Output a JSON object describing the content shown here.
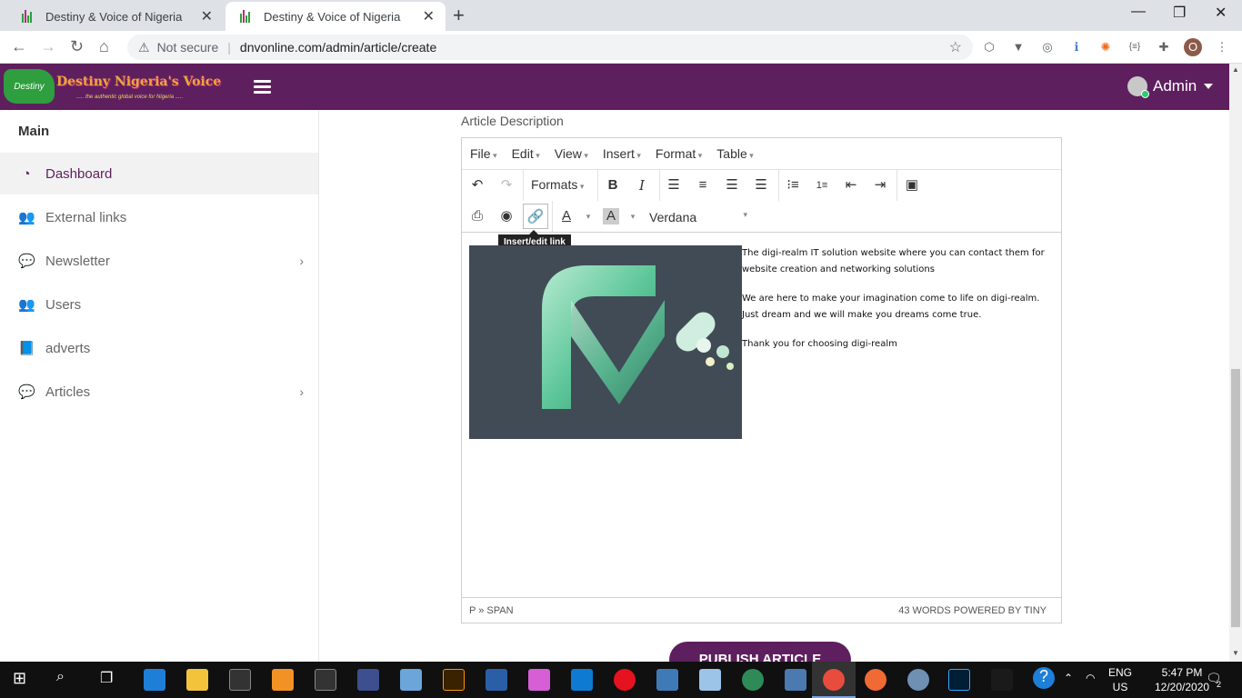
{
  "browser": {
    "tabs": [
      {
        "title": "Destiny & Voice of Nigeria",
        "active": false
      },
      {
        "title": "Destiny & Voice of Nigeria",
        "active": true
      }
    ],
    "security_label": "Not secure",
    "url": "dnvonline.com/admin/article/create",
    "profile_initial": "O"
  },
  "header": {
    "logo_badge": "Destiny",
    "logo_text": "Destiny Nigeria's Voice",
    "logo_tagline": "..... the authentic global voice for Nigeria .....",
    "admin_label": "Admin"
  },
  "sidebar": {
    "section_title": "Main",
    "items": [
      {
        "label": "Dashboard",
        "icon": "dashboard-icon",
        "glyph": "◔",
        "active": true,
        "has_children": false
      },
      {
        "label": "External links",
        "icon": "users-icon",
        "glyph": "👥",
        "active": false,
        "has_children": false
      },
      {
        "label": "Newsletter",
        "icon": "comments-icon",
        "glyph": "💬",
        "active": false,
        "has_children": true
      },
      {
        "label": "Users",
        "icon": "users-icon",
        "glyph": "👥",
        "active": false,
        "has_children": false
      },
      {
        "label": "adverts",
        "icon": "book-icon",
        "glyph": "📘",
        "active": false,
        "has_children": false
      },
      {
        "label": "Articles",
        "icon": "comments-icon",
        "glyph": "💬",
        "active": false,
        "has_children": true
      }
    ]
  },
  "main": {
    "description_label": "Article Description",
    "editor": {
      "menu": [
        "File",
        "Edit",
        "View",
        "Insert",
        "Format",
        "Table"
      ],
      "formats_label": "Formats",
      "font_family": "Verdana",
      "tooltip": "Insert/edit link",
      "paragraphs": [
        "The digi-realm IT solution website where you can contact them for website creation and networking solutions",
        "We are here to make your imagination come to life on digi-realm. Just dream and we will make you dreams come true.",
        "Thank you for choosing digi-realm"
      ],
      "status_path": "P » SPAN",
      "status_words": "43 words powered by tiny"
    },
    "publish_label": "PUBLISH ARTICLE"
  },
  "taskbar": {
    "lang_top": "ENG",
    "lang_bottom": "US",
    "time": "5:47 PM",
    "date": "12/20/2020",
    "notification_count": "2"
  },
  "colors": {
    "brand_purple": "#5e1f5e",
    "logo_green": "#2e9e3e"
  }
}
